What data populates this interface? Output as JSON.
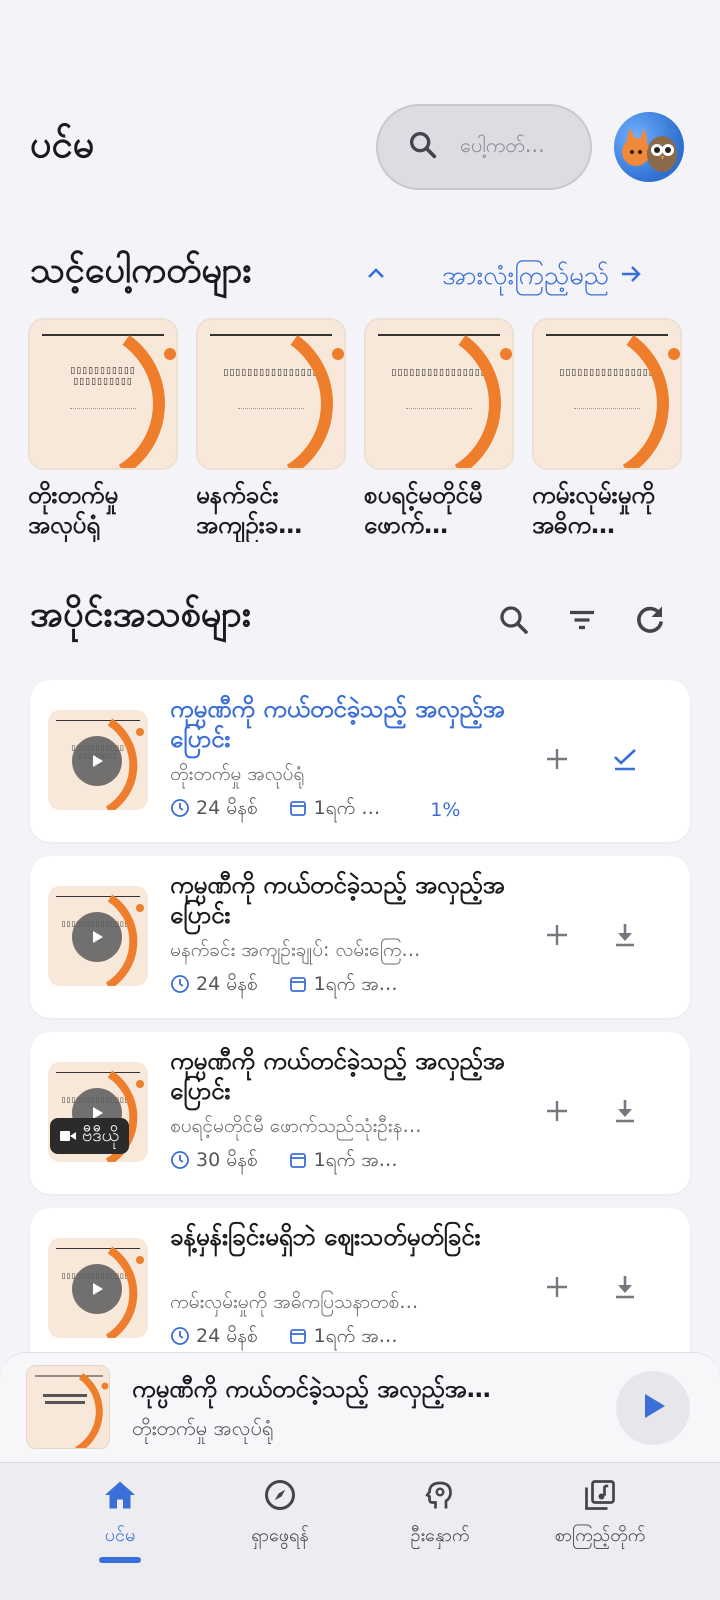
{
  "header": {
    "title": "ပင်မ",
    "search_placeholder": "ပေါ့ကတ်…",
    "avatar_icon": "fox-owl-avatar"
  },
  "your_podcasts": {
    "title": "သင့်ပေါ့ကတ်များ",
    "see_all_label": "အားလုံးကြည့်မည်",
    "books": [
      {
        "title": "တိုးတက်မှု အလုပ်ရုံ",
        "cover_text": "▯▯▯▯▯▯▯▯▯▯▯ ▯▯▯▯▯▯▯▯▯▯"
      },
      {
        "title": "မနက်ခင်း အကျဉ်းခ…",
        "cover_text": "▯▯▯▯▯▯▯▯▯▯▯▯▯▯▯▯"
      },
      {
        "title": "စပရင့်မတိုင်မီ ဖောက်…",
        "cover_text": "▯▯▯▯▯▯▯▯▯▯▯▯▯▯▯▯"
      },
      {
        "title": "ကမ်းလုမ်းမှုကို အဓိက…",
        "cover_text": "▯▯▯▯▯▯▯▯▯▯▯▯▯▯▯▯"
      }
    ]
  },
  "episodes_section": {
    "title": "အပိုင်းအသစ်များ",
    "episodes": [
      {
        "title": "ကုမ္ပဏီကို ကယ်တင်ခဲ့သည့် အလှည့်အပြောင်း",
        "subtitle": "တိုးတက်မှု အလုပ်ရုံ",
        "duration": "24 မိနစ်",
        "date": "1ရက် …",
        "progress": "1%",
        "active": true,
        "action_icon": "done-check-icon"
      },
      {
        "title": "ကုမ္ပဏီကို ကယ်တင်ခဲ့သည့် အလှည့်အပြောင်း",
        "subtitle": "မနက်ခင်း အကျဉ်းချုပ်: လမ်းကြေ…",
        "duration": "24 မိနစ်",
        "date": "1ရက် အ…",
        "progress": "",
        "active": false,
        "action_icon": "download-icon"
      },
      {
        "title": "ကုမ္ပဏီကို ကယ်တင်ခဲ့သည့် အလှည့်အပြောင်း",
        "subtitle": "စပရင့်မတိုင်မီ ဖောက်သည်သုံးဦးန…",
        "duration": "30 မိနစ်",
        "date": "1ရက် အ…",
        "progress": "",
        "active": false,
        "action_icon": "download-icon",
        "badge": "ဗီဒီယို"
      },
      {
        "title": "ခန့်မှန်းခြင်းမရှိဘဲ ဈေးသတ်မှတ်ခြင်း",
        "subtitle": "ကမ်းလှမ်းမှုကို အဓိကပြသနာတစ်…",
        "duration": "24 မိနစ်",
        "date": "1ရက် အ…",
        "progress": "",
        "active": false,
        "action_icon": "download-icon"
      }
    ]
  },
  "mini_player": {
    "title": "ကုမ္ပဏီကို ကယ်တင်ခဲ့သည့် အလှည့်အ…",
    "subtitle": "တိုးတက်မှု အလုပ်ရုံ"
  },
  "bottom_nav": [
    {
      "label": "ပင်မ",
      "icon": "home-icon",
      "active": true
    },
    {
      "label": "ရှာဖွေရန်",
      "icon": "compass-icon",
      "active": false
    },
    {
      "label": "ဦးနှောက်",
      "icon": "brain-icon",
      "active": false
    },
    {
      "label": "စာကြည့်တိုက်",
      "icon": "library-music-icon",
      "active": false
    }
  ],
  "colors": {
    "accent": "#3a6fd8",
    "cover_orange": "#ee7d2c",
    "cover_bg": "#f8e8da",
    "background": "#f4f4f8"
  }
}
